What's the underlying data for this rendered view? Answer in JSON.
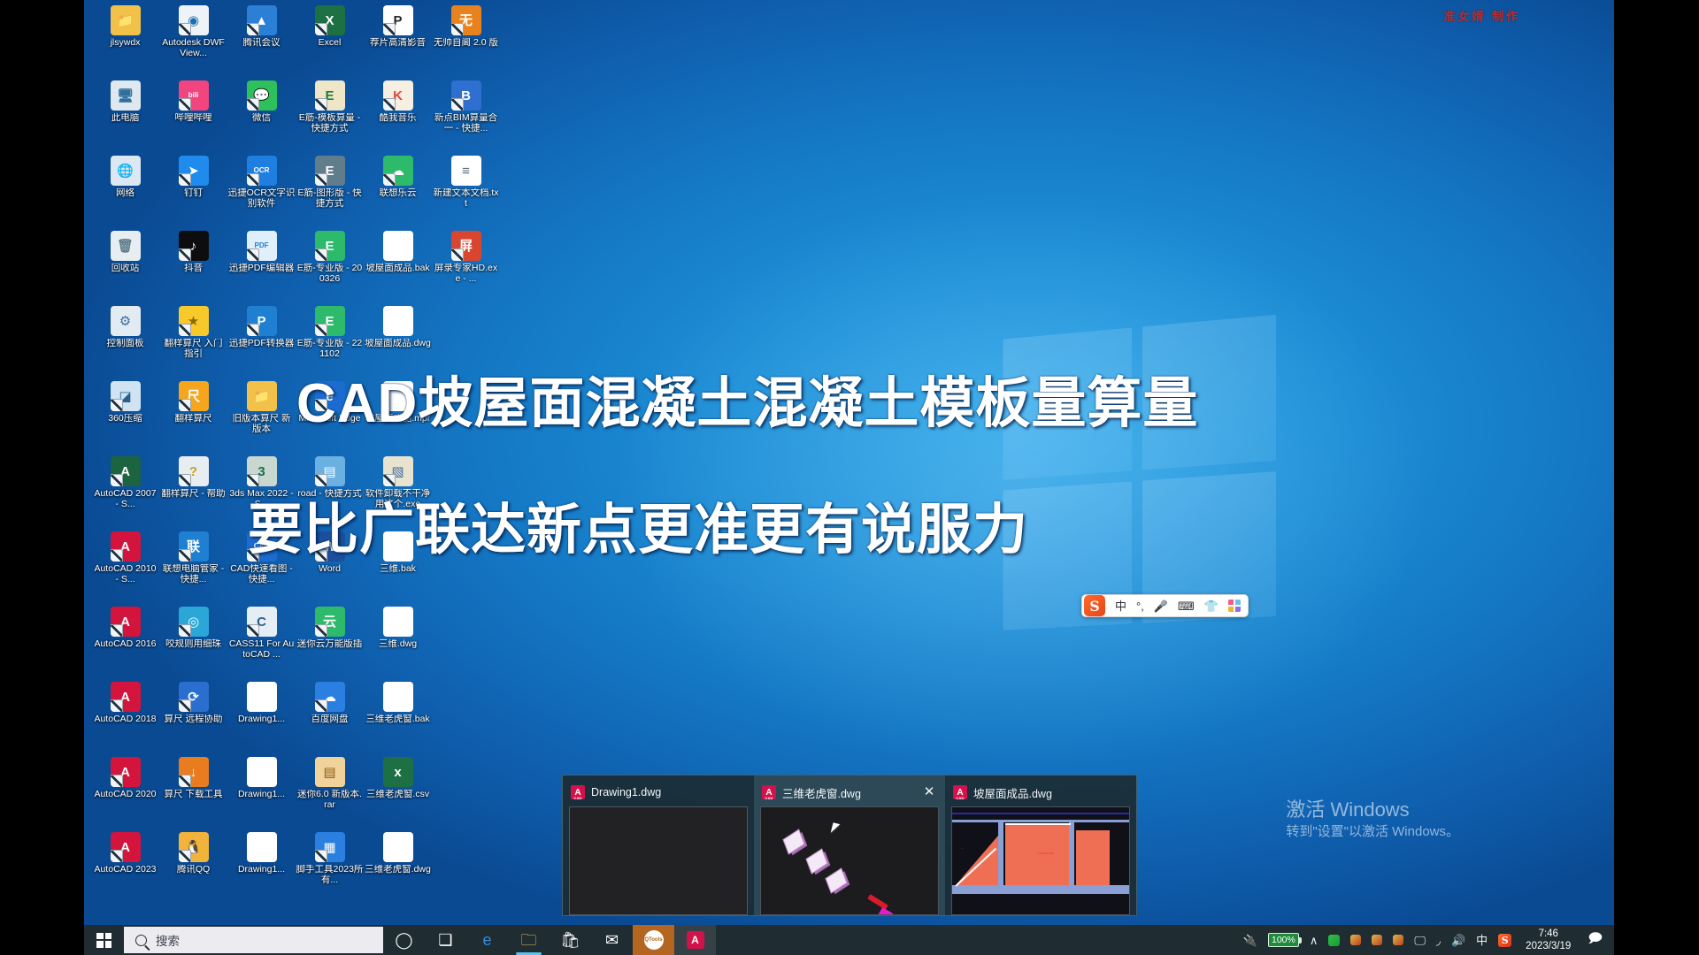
{
  "meta": {
    "os": "Windows 10",
    "credit_text": "准女婿 制作",
    "credit_color": "#c32a2a"
  },
  "overlay": {
    "line1": "CAD坡屋面混凝土混凝土模板量算量",
    "line2": "要比广联达新点更准更有说服力",
    "color": "#ffffff"
  },
  "desktop": {
    "icons": [
      {
        "label": "jlsywdx",
        "icon": "folder-user-icon",
        "bg": "#f2c14a",
        "fg": "#7a5a10",
        "glyph": "📁",
        "shortcut": false
      },
      {
        "label": "Autodesk DWF View...",
        "icon": "autodesk-dwf-viewer-icon",
        "bg": "#eef3f7",
        "fg": "#1a6fae",
        "glyph": "◉",
        "shortcut": true
      },
      {
        "label": "腾讯会议",
        "icon": "tencent-meeting-icon",
        "bg": "#2b7fd4",
        "fg": "#ffffff",
        "glyph": "▲",
        "shortcut": true
      },
      {
        "label": "Excel",
        "icon": "excel-icon",
        "bg": "#1d7044",
        "fg": "#ffffff",
        "glyph": "X",
        "shortcut": true
      },
      {
        "label": "荐片高清影音",
        "icon": "jianpian-player-icon",
        "bg": "#ffffff",
        "fg": "#23272b",
        "glyph": "P",
        "shortcut": true
      },
      {
        "label": "无帅自阃 2.0 版",
        "icon": "wushuai-icon",
        "bg": "#e8821e",
        "fg": "#ffffff",
        "glyph": "无",
        "shortcut": true
      },
      {
        "label": "此电脑",
        "icon": "this-pc-icon",
        "bg": "#dfe8ef",
        "fg": "#2f6f9e",
        "glyph": "🖥",
        "shortcut": false
      },
      {
        "label": "哔哩哔哩",
        "icon": "bilibili-icon",
        "bg": "#f2447f",
        "fg": "#ffffff",
        "glyph": "bili",
        "shortcut": true
      },
      {
        "label": "微信",
        "icon": "wechat-icon",
        "bg": "#2ec05a",
        "fg": "#ffffff",
        "glyph": "💬",
        "shortcut": true
      },
      {
        "label": "E筋-模板算量 - 快捷方式",
        "icon": "ejin-template-icon",
        "bg": "#efe6c8",
        "fg": "#1d7a3e",
        "glyph": "E",
        "shortcut": true
      },
      {
        "label": "酷我音乐",
        "icon": "kuwo-music-icon",
        "bg": "#f6efe2",
        "fg": "#e0473a",
        "glyph": "K",
        "shortcut": true
      },
      {
        "label": "新点BIM算量合一 - 快捷...",
        "icon": "xindian-bim-icon",
        "bg": "#2f6fd0",
        "fg": "#ffffff",
        "glyph": "B",
        "shortcut": true
      },
      {
        "label": "网络",
        "icon": "network-icon",
        "bg": "#dbe7f1",
        "fg": "#2e6b9c",
        "glyph": "🌐",
        "shortcut": false
      },
      {
        "label": "钉钉",
        "icon": "dingtalk-icon",
        "bg": "#1f8bec",
        "fg": "#ffffff",
        "glyph": "➤",
        "shortcut": true
      },
      {
        "label": "迅捷OCR文字识别软件",
        "icon": "xunjie-ocr-icon",
        "bg": "#1e7fe0",
        "fg": "#ffffff",
        "glyph": "OCR",
        "shortcut": true
      },
      {
        "label": "E筋-图形版 - 快捷方式",
        "icon": "ejin-graphic-icon",
        "bg": "#607d8b",
        "fg": "#ffffff",
        "glyph": "E",
        "shortcut": true
      },
      {
        "label": "联想乐云",
        "icon": "lenovo-cloud-icon",
        "bg": "#2dba6a",
        "fg": "#ffffff",
        "glyph": "☁",
        "shortcut": true
      },
      {
        "label": "新建文本文档.txt",
        "icon": "text-document-icon",
        "bg": "#ffffff",
        "fg": "#5a6b77",
        "glyph": "≡",
        "shortcut": false
      },
      {
        "label": "回收站",
        "icon": "recycle-bin-icon",
        "bg": "#e7edf1",
        "fg": "#5f7d8c",
        "glyph": "🗑",
        "shortcut": false
      },
      {
        "label": "抖音",
        "icon": "douyin-icon",
        "bg": "#0d0d10",
        "fg": "#ffffff",
        "glyph": "♪",
        "shortcut": true
      },
      {
        "label": "迅捷PDF编辑器",
        "icon": "xunjie-pdf-editor-icon",
        "bg": "#dff0fb",
        "fg": "#1f7fd0",
        "glyph": "PDF",
        "shortcut": true
      },
      {
        "label": "E筋-专业版 - 200326",
        "icon": "ejin-pro-200326-icon",
        "bg": "#2dba6a",
        "fg": "#ffffff",
        "glyph": "E",
        "shortcut": true
      },
      {
        "label": "坡屋面成品.bak",
        "icon": "bak-file-icon",
        "bg": "#ffffff",
        "fg": "#8a9aa6",
        "glyph": "",
        "shortcut": false
      },
      {
        "label": "屏录专家HD.exe - ...",
        "icon": "screen-recorder-icon",
        "bg": "#d8462f",
        "fg": "#ffffff",
        "glyph": "屏",
        "shortcut": true
      },
      {
        "label": "控制面板",
        "icon": "control-panel-icon",
        "bg": "#e3ebf2",
        "fg": "#3b6e99",
        "glyph": "⚙",
        "shortcut": false
      },
      {
        "label": "翻样算尺 入门指引",
        "icon": "fanyang-guide-icon",
        "bg": "#f7c92b",
        "fg": "#8a6a00",
        "glyph": "★",
        "shortcut": true
      },
      {
        "label": "迅捷PDF转换器",
        "icon": "xunjie-pdf-converter-icon",
        "bg": "#1f7fd0",
        "fg": "#ffffff",
        "glyph": "P",
        "shortcut": true
      },
      {
        "label": "E筋-专业版 - 221102",
        "icon": "ejin-pro-221102-icon",
        "bg": "#2dba6a",
        "fg": "#ffffff",
        "glyph": "E",
        "shortcut": true
      },
      {
        "label": "坡屋面成品.dwg",
        "icon": "dwg-file-icon",
        "bg": "#ffffff",
        "fg": "#1b1b1b",
        "glyph": "",
        "shortcut": false
      },
      {
        "label": "",
        "icon": "empty-slot",
        "bg": "transparent",
        "fg": "transparent",
        "glyph": "",
        "shortcut": false
      },
      {
        "label": "360压缩",
        "icon": "360-zip-icon",
        "bg": "#cfe3f2",
        "fg": "#2a5f8c",
        "glyph": "◪",
        "shortcut": true
      },
      {
        "label": "翻样算尺",
        "icon": "fanyang-ruler-icon",
        "bg": "#f6a61d",
        "fg": "#ffffff",
        "glyph": "尺",
        "shortcut": true
      },
      {
        "label": "旧版本算尺 新版本",
        "icon": "old-ruler-folder-icon",
        "bg": "#f2c14a",
        "fg": "#7a5a10",
        "glyph": "📁",
        "shortcut": false
      },
      {
        "label": "Microsoft Edge",
        "icon": "microsoft-edge-icon",
        "bg": "#1c6bd0",
        "fg": "#ffffff",
        "glyph": "e",
        "shortcut": true
      },
      {
        "label": "坡屋面成品.mpr",
        "icon": "mpr-file-icon",
        "bg": "#ffffff",
        "fg": "#8a9aa6",
        "glyph": "",
        "shortcut": false
      },
      {
        "label": "",
        "icon": "empty-slot",
        "bg": "transparent",
        "fg": "transparent",
        "glyph": "",
        "shortcut": false
      },
      {
        "label": "AutoCAD 2007 - S...",
        "icon": "autocad-2007-icon",
        "bg": "#1c6340",
        "fg": "#ffffff",
        "glyph": "A",
        "shortcut": true
      },
      {
        "label": "翻样算尺 - 帮助",
        "icon": "fanyang-help-icon",
        "bg": "#e8edf2",
        "fg": "#c9a227",
        "glyph": "?",
        "shortcut": true
      },
      {
        "label": "3ds Max 2022 - S...",
        "icon": "3ds-max-2022-icon",
        "bg": "#c8d8d0",
        "fg": "#1d6b4a",
        "glyph": "3",
        "shortcut": true
      },
      {
        "label": "road - 快捷方式",
        "icon": "road-shortcut-icon",
        "bg": "#6ab0e0",
        "fg": "#ffffff",
        "glyph": "▤",
        "shortcut": true
      },
      {
        "label": "软件卸载不干净用这个.exe",
        "icon": "uninstaller-icon",
        "bg": "#e8e2cf",
        "fg": "#3a6b9c",
        "glyph": "▧",
        "shortcut": true
      },
      {
        "label": "",
        "icon": "empty-slot",
        "bg": "transparent",
        "fg": "transparent",
        "glyph": "",
        "shortcut": false
      },
      {
        "label": "AutoCAD 2010 - S...",
        "icon": "autocad-2010-icon",
        "bg": "#d3143c",
        "fg": "#ffffff",
        "glyph": "A",
        "shortcut": true
      },
      {
        "label": "联想电脑管家 - 快捷...",
        "icon": "lenovo-manager-icon",
        "bg": "#1f7fd0",
        "fg": "#ffffff",
        "glyph": "联",
        "shortcut": true
      },
      {
        "label": "CAD快速看图 - 快捷...",
        "icon": "cad-quick-view-icon",
        "bg": "#1c6bd0",
        "fg": "#ffffff",
        "glyph": "CAD",
        "shortcut": true
      },
      {
        "label": "Word",
        "icon": "word-icon",
        "bg": "#1b4f9c",
        "fg": "#ffffff",
        "glyph": "W",
        "shortcut": true
      },
      {
        "label": "三维.bak",
        "icon": "sanwei-bak-icon",
        "bg": "#ffffff",
        "fg": "#8a9aa6",
        "glyph": "",
        "shortcut": false
      },
      {
        "label": "",
        "icon": "empty-slot",
        "bg": "transparent",
        "fg": "transparent",
        "glyph": "",
        "shortcut": false
      },
      {
        "label": "AutoCAD 2016",
        "icon": "autocad-2016-icon",
        "bg": "#d3143c",
        "fg": "#ffffff",
        "glyph": "A",
        "shortcut": true
      },
      {
        "label": "咬规则用细珠",
        "icon": "yaoguize-icon",
        "bg": "#2aa7d6",
        "fg": "#ffffff",
        "glyph": "◎",
        "shortcut": true
      },
      {
        "label": "CASS11 For AutoCAD ...",
        "icon": "cass11-icon",
        "bg": "#e6eef5",
        "fg": "#2a5f8c",
        "glyph": "C",
        "shortcut": true
      },
      {
        "label": "迷你云万能版插",
        "icon": "miniyun-icon",
        "bg": "#2dba6a",
        "fg": "#ffffff",
        "glyph": "云",
        "shortcut": true
      },
      {
        "label": "三维.dwg",
        "icon": "sanwei-dwg-icon",
        "bg": "#ffffff",
        "fg": "#1b1b1b",
        "glyph": "",
        "shortcut": false
      },
      {
        "label": "",
        "icon": "empty-slot",
        "bg": "transparent",
        "fg": "transparent",
        "glyph": "",
        "shortcut": false
      },
      {
        "label": "AutoCAD 2018",
        "icon": "autocad-2018-icon",
        "bg": "#d3143c",
        "fg": "#ffffff",
        "glyph": "A",
        "shortcut": true
      },
      {
        "label": "算尺 远程协助",
        "icon": "remote-help-icon",
        "bg": "#2a6fd0",
        "fg": "#ffffff",
        "glyph": "⟳",
        "shortcut": true
      },
      {
        "label": "Drawing1...",
        "icon": "drawing1-doc-icon",
        "bg": "#ffffff",
        "fg": "#8a9aa6",
        "glyph": "",
        "shortcut": false
      },
      {
        "label": "百度网盘",
        "icon": "baidu-netdisk-icon",
        "bg": "#2a7fe0",
        "fg": "#ffffff",
        "glyph": "☁",
        "shortcut": true
      },
      {
        "label": "三维老虎窗.bak",
        "icon": "dormer-bak-icon",
        "bg": "#ffffff",
        "fg": "#8a9aa6",
        "glyph": "",
        "shortcut": false
      },
      {
        "label": "",
        "icon": "empty-slot",
        "bg": "transparent",
        "fg": "transparent",
        "glyph": "",
        "shortcut": false
      },
      {
        "label": "AutoCAD 2020",
        "icon": "autocad-2020-icon",
        "bg": "#d3143c",
        "fg": "#ffffff",
        "glyph": "A",
        "shortcut": true
      },
      {
        "label": "算尺 下载工具",
        "icon": "ruler-download-icon",
        "bg": "#e87c1e",
        "fg": "#ffffff",
        "glyph": "↓",
        "shortcut": true
      },
      {
        "label": "Drawing1...",
        "icon": "drawing1-doc2-icon",
        "bg": "#ffffff",
        "fg": "#8a9aa6",
        "glyph": "",
        "shortcut": false
      },
      {
        "label": "迷你6.0 新版本.rar",
        "icon": "mini60-rar-icon",
        "bg": "#f0d29a",
        "fg": "#8a5a10",
        "glyph": "▤",
        "shortcut": false
      },
      {
        "label": "三维老虎窗.csv",
        "icon": "dormer-csv-icon",
        "bg": "#1d7044",
        "fg": "#ffffff",
        "glyph": "x",
        "shortcut": false
      },
      {
        "label": "",
        "icon": "empty-slot",
        "bg": "transparent",
        "fg": "transparent",
        "glyph": "",
        "shortcut": false
      },
      {
        "label": "AutoCAD 2023",
        "icon": "autocad-2023-icon",
        "bg": "#d3143c",
        "fg": "#ffffff",
        "glyph": "A",
        "shortcut": true
      },
      {
        "label": "腾讯QQ",
        "icon": "tencent-qq-icon",
        "bg": "#f2b33a",
        "fg": "#ffffff",
        "glyph": "🐧",
        "shortcut": true
      },
      {
        "label": "Drawing1...",
        "icon": "drawing1-doc3-icon",
        "bg": "#ffffff",
        "fg": "#8a9aa6",
        "glyph": "",
        "shortcut": false
      },
      {
        "label": "脚手工具2023所有...",
        "icon": "scaffold-tool-icon",
        "bg": "#2a7fe0",
        "fg": "#ffffff",
        "glyph": "▦",
        "shortcut": true
      },
      {
        "label": "三维老虎窗.dwg",
        "icon": "dormer-dwg-icon",
        "bg": "#ffffff",
        "fg": "#1b1b1b",
        "glyph": "",
        "shortcut": false
      },
      {
        "label": "",
        "icon": "empty-slot",
        "bg": "transparent",
        "fg": "transparent",
        "glyph": "",
        "shortcut": false
      }
    ]
  },
  "ime": {
    "brand": "S",
    "mode": "中",
    "items": [
      "°,",
      "mic-icon",
      "keyboard-icon",
      "skin-icon",
      "apps-icon"
    ]
  },
  "activation": {
    "title": "激活 Windows",
    "subtitle": "转到\"设置\"以激活 Windows。"
  },
  "previews": {
    "items": [
      {
        "title": "Drawing1.dwg",
        "app_icon": "autocad-icon",
        "active": false,
        "show_close": false,
        "thumb": "blank"
      },
      {
        "title": "三维老虎窗.dwg",
        "app_icon": "autocad-icon",
        "active": true,
        "show_close": true,
        "thumb": "dormer-3d"
      },
      {
        "title": "坡屋面成品.dwg",
        "app_icon": "autocad-icon",
        "active": false,
        "show_close": false,
        "thumb": "roof-plan"
      }
    ],
    "close_glyph": "✕"
  },
  "taskbar": {
    "start": {
      "name": "start-button",
      "glyph": "windows-logo-icon"
    },
    "search": {
      "placeholder": "搜索",
      "icon": "search-icon"
    },
    "buttons": [
      {
        "name": "cortana-button",
        "label": "cortana-icon",
        "glyph": "◯",
        "color": "#ffffff",
        "state": "normal"
      },
      {
        "name": "task-view-button",
        "label": "task-view-icon",
        "glyph": "❏",
        "color": "#ffffff",
        "state": "normal"
      },
      {
        "name": "edge-button",
        "label": "microsoft-edge-icon",
        "glyph": "e",
        "color": "#2e8fe0",
        "state": "normal"
      },
      {
        "name": "file-explorer-button",
        "label": "file-explorer-icon",
        "glyph": "🗀",
        "color": "#f0c24a",
        "state": "running"
      },
      {
        "name": "microsoft-store-button",
        "label": "microsoft-store-icon",
        "glyph": "🛍",
        "color": "#ffffff",
        "state": "normal"
      },
      {
        "name": "mail-button",
        "label": "mail-icon",
        "glyph": "✉",
        "color": "#ffffff",
        "state": "normal"
      },
      {
        "name": "qtools-button",
        "label": "qtools-icon",
        "glyph": "QTools",
        "color": "#ffffff",
        "state": "highlight-orange"
      },
      {
        "name": "autocad-button",
        "label": "autocad-icon",
        "glyph": "A",
        "color": "#ffffff",
        "state": "highlight-dim"
      }
    ],
    "tray": {
      "power_icon": "power-plug-icon",
      "battery": "100%",
      "chevron": "∧",
      "icons": [
        "recycle-icon",
        "user-icon",
        "user-icon",
        "user-icon",
        "display-icon",
        "wifi-icon",
        "volume-icon"
      ],
      "ime_indicator": "中",
      "sogou_indicator": "S"
    },
    "clock": {
      "time": "7:46",
      "date": "2023/3/19"
    },
    "notifications": {
      "icon": "action-center-icon",
      "glyph": "🗩"
    }
  }
}
